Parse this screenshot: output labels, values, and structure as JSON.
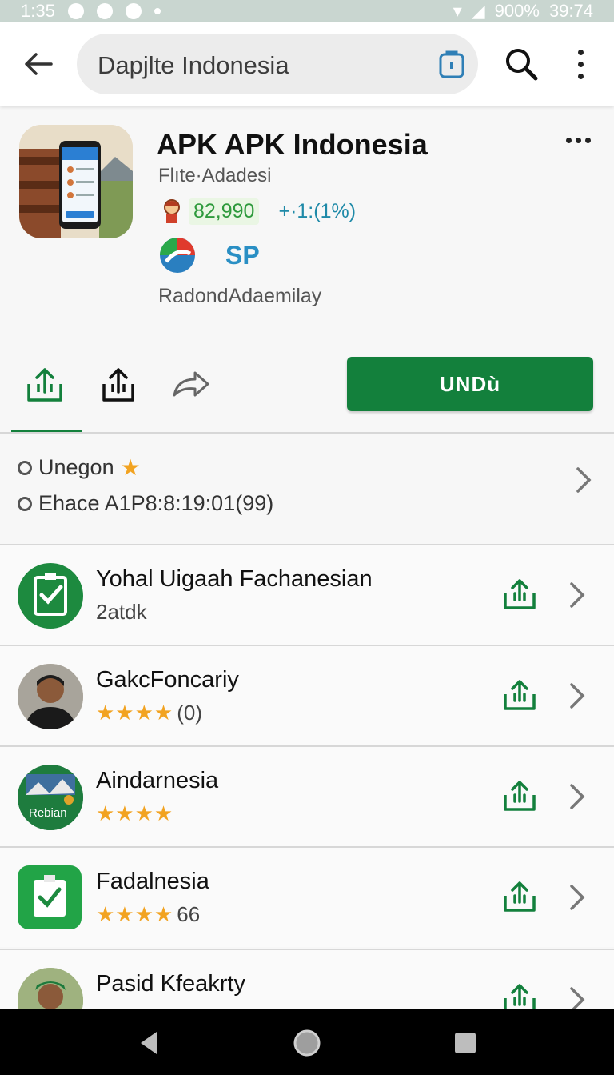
{
  "status": {
    "time": "1:35",
    "battery": "900%",
    "clock": "39:74"
  },
  "search": {
    "query": "Dapjlte Indonesia"
  },
  "app": {
    "title": "APK APK Indonesia",
    "developer": "Flıte·Adadesi",
    "rating": "82,990",
    "rating_delta": "+·1:(1%)",
    "badge_text": "SP",
    "subtitle": "RadondAdaemilay",
    "install_label": "UNDù"
  },
  "info": {
    "line1": "Unegon",
    "line2": "Ehace A1P8:8:19:01(99)"
  },
  "list": [
    {
      "title": "Yohal Uigaah Fachanesian",
      "sub": "2atdk",
      "stars": "",
      "count": ""
    },
    {
      "title": "GakcFoncariy",
      "sub": "",
      "stars": "★★★★",
      "count": "(0)"
    },
    {
      "title": "Aindarnesia",
      "sub": "",
      "stars": "★★★★",
      "count": ""
    },
    {
      "title": "Fadalnesia",
      "sub": "",
      "stars": "★★★★",
      "count": "66"
    },
    {
      "title": "Pasid Kfeakrty",
      "sub": "",
      "stars": "",
      "count": ""
    }
  ],
  "icon_badge_text": "Rebian",
  "colors": {
    "accent": "#13803c",
    "star": "#f2a321",
    "link_blue": "#2a8fc4"
  }
}
